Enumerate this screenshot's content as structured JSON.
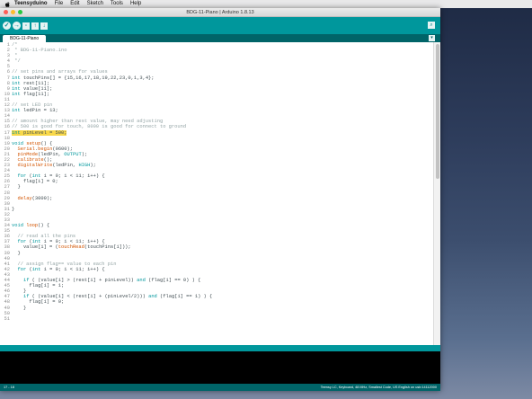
{
  "menubar": {
    "app_name": "Teensyduino",
    "items": [
      "File",
      "Edit",
      "Sketch",
      "Tools",
      "Help"
    ]
  },
  "window": {
    "title": "BDG-11-Piano | Arduino 1.8.13",
    "tab_name": "BDG-11-Piano"
  },
  "editor": {
    "highlighted_line": 17,
    "lines": [
      {
        "n": "1",
        "segs": [
          {
            "t": "/*",
            "c": "cm"
          }
        ]
      },
      {
        "n": "2",
        "segs": [
          {
            "t": " * BDG-11-Piano.ino",
            "c": "cm"
          }
        ]
      },
      {
        "n": "3",
        "segs": [
          {
            "t": " *",
            "c": "cm"
          }
        ]
      },
      {
        "n": "4",
        "segs": [
          {
            "t": " */",
            "c": "cm"
          }
        ]
      },
      {
        "n": "5",
        "segs": []
      },
      {
        "n": "6",
        "segs": [
          {
            "t": "// set pins and arrays for values",
            "c": "cm"
          }
        ]
      },
      {
        "n": "7",
        "segs": [
          {
            "t": "int",
            "c": "kw"
          },
          {
            "t": " touchPins[] = {15,16,17,18,19,22,23,0,1,3,4};",
            "c": ""
          }
        ]
      },
      {
        "n": "8",
        "segs": [
          {
            "t": "int",
            "c": "kw"
          },
          {
            "t": " rest[11];",
            "c": ""
          }
        ]
      },
      {
        "n": "9",
        "segs": [
          {
            "t": "int",
            "c": "kw"
          },
          {
            "t": " value[11];",
            "c": ""
          }
        ]
      },
      {
        "n": "10",
        "segs": [
          {
            "t": "int",
            "c": "kw"
          },
          {
            "t": " flag[11];",
            "c": ""
          }
        ]
      },
      {
        "n": "11",
        "segs": []
      },
      {
        "n": "12",
        "segs": [
          {
            "t": "// set LED pin",
            "c": "cm"
          }
        ]
      },
      {
        "n": "13",
        "segs": [
          {
            "t": "int",
            "c": "kw"
          },
          {
            "t": " ledPin = 13;",
            "c": ""
          }
        ]
      },
      {
        "n": "14",
        "segs": []
      },
      {
        "n": "15",
        "segs": [
          {
            "t": "// amount higher than rest value, may need adjusting",
            "c": "cm"
          }
        ]
      },
      {
        "n": "16",
        "segs": [
          {
            "t": "// 500 is good for touch, 8000 is good for connect to ground",
            "c": "cm"
          }
        ]
      },
      {
        "n": "17",
        "segs": [
          {
            "t": "int",
            "c": "kw"
          },
          {
            "t": " pinLevel = 500;",
            "c": ""
          }
        ]
      },
      {
        "n": "18",
        "segs": []
      },
      {
        "n": "19",
        "segs": [
          {
            "t": "void",
            "c": "kw"
          },
          {
            "t": " ",
            "c": ""
          },
          {
            "t": "setup",
            "c": "fn"
          },
          {
            "t": "() {",
            "c": ""
          }
        ]
      },
      {
        "n": "20",
        "segs": [
          {
            "t": "  ",
            "c": ""
          },
          {
            "t": "Serial",
            "c": "fn"
          },
          {
            "t": ".",
            "c": ""
          },
          {
            "t": "begin",
            "c": "fn"
          },
          {
            "t": "(9600);",
            "c": ""
          }
        ]
      },
      {
        "n": "21",
        "segs": [
          {
            "t": "  ",
            "c": ""
          },
          {
            "t": "pinMode",
            "c": "fn"
          },
          {
            "t": "(ledPin, ",
            "c": ""
          },
          {
            "t": "OUTPUT",
            "c": "lit"
          },
          {
            "t": ");",
            "c": ""
          }
        ]
      },
      {
        "n": "22",
        "segs": [
          {
            "t": "  ",
            "c": ""
          },
          {
            "t": "calibrate",
            "c": "fn"
          },
          {
            "t": "();",
            "c": ""
          }
        ]
      },
      {
        "n": "23",
        "segs": [
          {
            "t": "  ",
            "c": ""
          },
          {
            "t": "digitalWrite",
            "c": "fn"
          },
          {
            "t": "(ledPin, ",
            "c": ""
          },
          {
            "t": "HIGH",
            "c": "lit"
          },
          {
            "t": ");",
            "c": ""
          }
        ]
      },
      {
        "n": "24",
        "segs": []
      },
      {
        "n": "25",
        "segs": [
          {
            "t": "  ",
            "c": ""
          },
          {
            "t": "for",
            "c": "kw"
          },
          {
            "t": " (",
            "c": ""
          },
          {
            "t": "int",
            "c": "kw"
          },
          {
            "t": " i = 0; i < 11; i++) {",
            "c": ""
          }
        ]
      },
      {
        "n": "26",
        "segs": [
          {
            "t": "    flag[i] = 0;",
            "c": ""
          }
        ]
      },
      {
        "n": "27",
        "segs": [
          {
            "t": "  }",
            "c": ""
          }
        ]
      },
      {
        "n": "28",
        "segs": []
      },
      {
        "n": "29",
        "segs": [
          {
            "t": "  ",
            "c": ""
          },
          {
            "t": "delay",
            "c": "fn"
          },
          {
            "t": "(3000);",
            "c": ""
          }
        ]
      },
      {
        "n": "30",
        "segs": []
      },
      {
        "n": "31",
        "segs": [
          {
            "t": "}",
            "c": ""
          }
        ]
      },
      {
        "n": "32",
        "segs": []
      },
      {
        "n": "33",
        "segs": []
      },
      {
        "n": "34",
        "segs": [
          {
            "t": "void",
            "c": "kw"
          },
          {
            "t": " ",
            "c": ""
          },
          {
            "t": "loop",
            "c": "fn"
          },
          {
            "t": "() {",
            "c": ""
          }
        ]
      },
      {
        "n": "35",
        "segs": []
      },
      {
        "n": "36",
        "segs": [
          {
            "t": "  // read all the pins",
            "c": "cm"
          }
        ]
      },
      {
        "n": "37",
        "segs": [
          {
            "t": "  ",
            "c": ""
          },
          {
            "t": "for",
            "c": "kw"
          },
          {
            "t": " (",
            "c": ""
          },
          {
            "t": "int",
            "c": "kw"
          },
          {
            "t": " i = 0; i < 11; i++) {",
            "c": ""
          }
        ]
      },
      {
        "n": "38",
        "segs": [
          {
            "t": "    value[i] = (",
            "c": ""
          },
          {
            "t": "touchRead",
            "c": "fn"
          },
          {
            "t": "(touchPins[i]));",
            "c": ""
          }
        ]
      },
      {
        "n": "39",
        "segs": [
          {
            "t": "  }",
            "c": ""
          }
        ]
      },
      {
        "n": "40",
        "segs": []
      },
      {
        "n": "41",
        "segs": [
          {
            "t": "  // assign flag== value to each pin",
            "c": "cm"
          }
        ]
      },
      {
        "n": "42",
        "segs": [
          {
            "t": "  ",
            "c": ""
          },
          {
            "t": "for",
            "c": "kw"
          },
          {
            "t": " (",
            "c": ""
          },
          {
            "t": "int",
            "c": "kw"
          },
          {
            "t": " i = 0; i < 11; i++) {",
            "c": ""
          }
        ]
      },
      {
        "n": "43",
        "segs": []
      },
      {
        "n": "44",
        "segs": [
          {
            "t": "    ",
            "c": ""
          },
          {
            "t": "if",
            "c": "kw"
          },
          {
            "t": " ( (value[i] > (rest[i] + pinLevel)) ",
            "c": ""
          },
          {
            "t": "and",
            "c": "kw"
          },
          {
            "t": " (flag[i] == 0) ) {",
            "c": ""
          }
        ]
      },
      {
        "n": "45",
        "segs": [
          {
            "t": "      flag[i] = 1;",
            "c": ""
          }
        ]
      },
      {
        "n": "46",
        "segs": [
          {
            "t": "    }",
            "c": ""
          }
        ]
      },
      {
        "n": "47",
        "segs": [
          {
            "t": "    ",
            "c": ""
          },
          {
            "t": "if",
            "c": "kw"
          },
          {
            "t": " ( (value[i] < (rest[i] + (pinLevel/2))) ",
            "c": ""
          },
          {
            "t": "and",
            "c": "kw"
          },
          {
            "t": " (flag[i] == 1) ) {",
            "c": ""
          }
        ]
      },
      {
        "n": "48",
        "segs": [
          {
            "t": "      flag[i] = 0;",
            "c": ""
          }
        ]
      },
      {
        "n": "49",
        "segs": [
          {
            "t": "    }",
            "c": ""
          }
        ]
      },
      {
        "n": "50",
        "segs": []
      },
      {
        "n": "51",
        "segs": []
      }
    ]
  },
  "status": {
    "cursor_position": "17 - 18",
    "board_info": "Teensy LC, Keyboard, 48 MHz, Smallest Code, US English on usb:14112000"
  },
  "colors": {
    "toolbar": "#00979c",
    "tabbar": "#006468",
    "highlight": "#f8d84a"
  }
}
